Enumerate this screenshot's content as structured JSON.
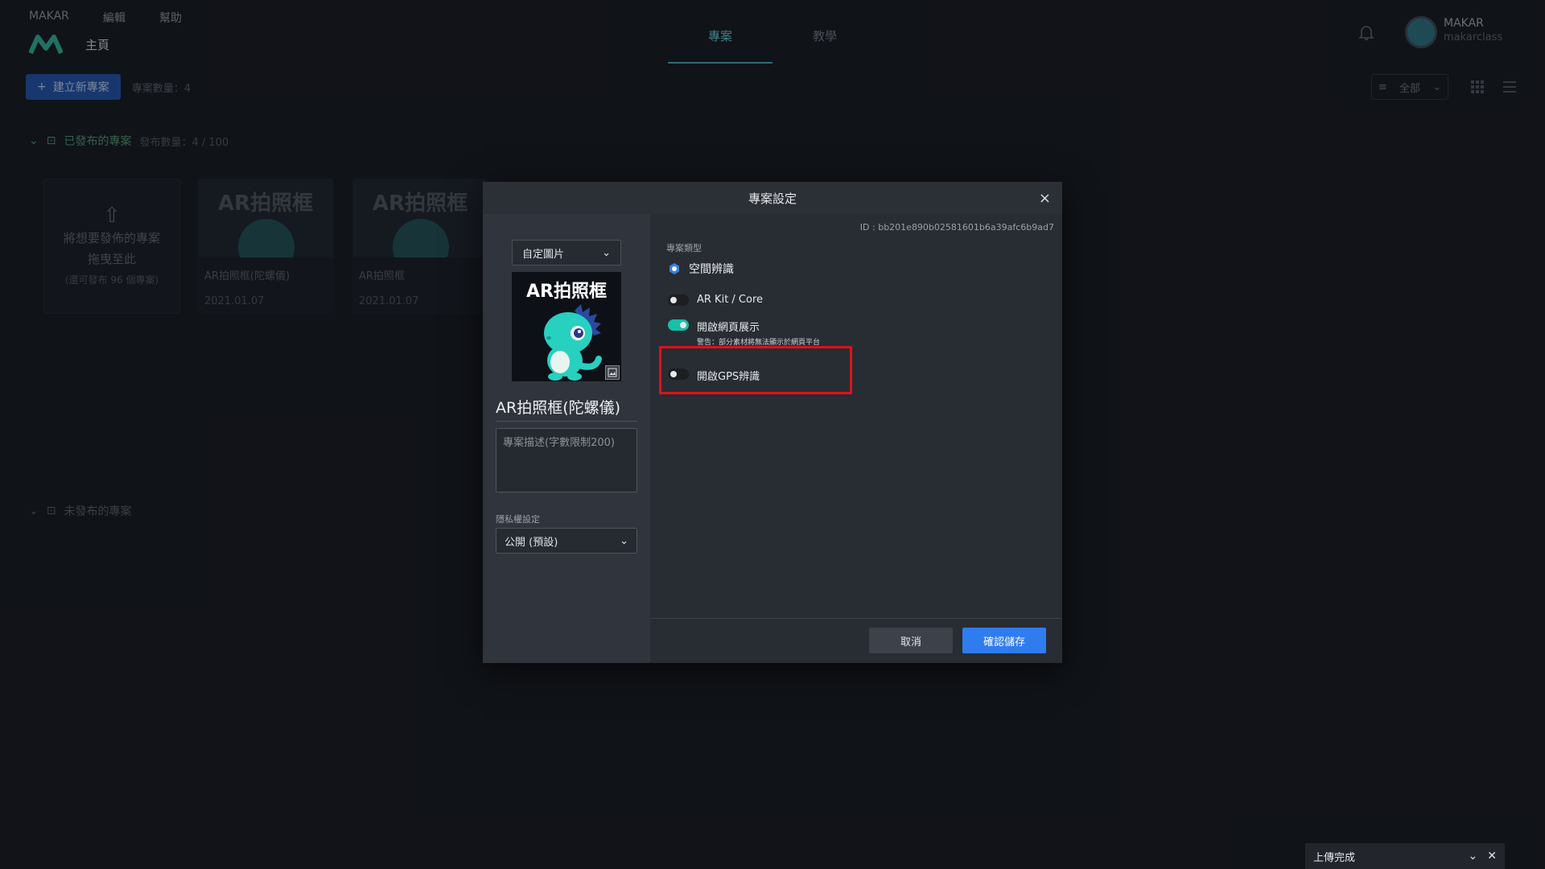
{
  "menu": {
    "items": [
      "MAKAR",
      "編輯",
      "幫助"
    ]
  },
  "nav": {
    "home": "主頁",
    "tabs": [
      "專案",
      "教學"
    ]
  },
  "user": {
    "name": "MAKAR",
    "sub": "makarclass"
  },
  "toolbar": {
    "new_project": "建立新專案",
    "project_count": "專案數量：4"
  },
  "filter": {
    "label": "全部"
  },
  "sections": {
    "published": {
      "title": "已發布的專案",
      "sub": "發布數量：4 / 100"
    },
    "unpublished": {
      "title": "未發布的專案"
    }
  },
  "upload_card": {
    "line1": "將想要發佈的專案",
    "line2": "拖曳至此",
    "hint": "(還可發布 96 個專案)"
  },
  "cards": [
    {
      "thumb_title": "AR拍照框",
      "name": "AR拍照框(陀螺儀)",
      "date": "2021.01.07"
    },
    {
      "thumb_title": "AR拍照框",
      "name": "AR拍照框",
      "date": "2021.01.07"
    }
  ],
  "modal": {
    "title": "專案設定",
    "close": "×",
    "cover_select": "自定圖片",
    "cover_title": "AR拍照框",
    "project_name": "AR拍照框(陀螺儀)",
    "description_placeholder": "專案描述(字數限制200)",
    "privacy_label": "隱私權設定",
    "privacy_value": "公開 (預設)",
    "project_id": "ID : bb201e890b02581601b6a39afc6b9ad7",
    "type_label": "專案類型",
    "radio_label": "空間辨識",
    "toggles": [
      {
        "label": "AR Kit / Core",
        "on": false
      },
      {
        "label": "開啟網頁展示",
        "warning": "警告：部分素材將無法顯示於網頁平台",
        "on": true
      },
      {
        "label": "開啟GPS辨識",
        "on": false
      }
    ],
    "cancel": "取消",
    "save": "確認儲存"
  },
  "toast": {
    "label": "上傳完成"
  },
  "colors": {
    "accent": "#18bfa8",
    "primary": "#2f7cf0",
    "highlight": "#e0101a"
  }
}
